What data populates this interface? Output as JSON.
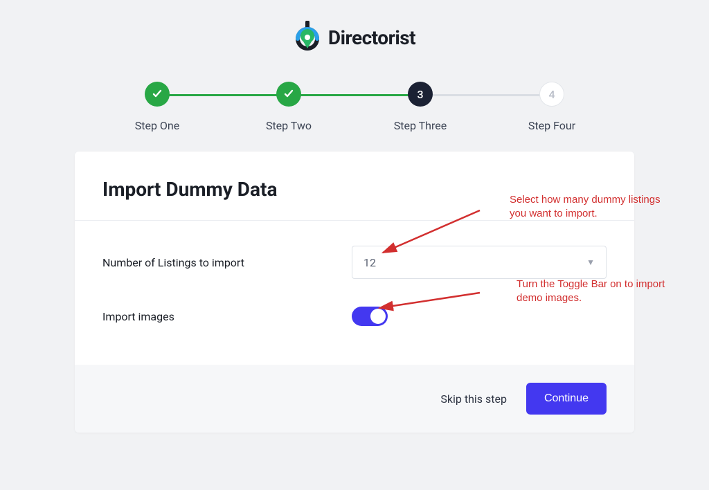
{
  "brand": {
    "name": "Directorist"
  },
  "stepper": {
    "steps": [
      {
        "label": "Step One",
        "state": "done",
        "display": "✓"
      },
      {
        "label": "Step Two",
        "state": "done",
        "display": "✓"
      },
      {
        "label": "Step Three",
        "state": "current",
        "display": "3"
      },
      {
        "label": "Step Four",
        "state": "pending",
        "display": "4"
      }
    ]
  },
  "card": {
    "title": "Import Dummy Data",
    "fields": {
      "listings_label": "Number of Listings to import",
      "listings_value": "12",
      "images_label": "Import images",
      "images_on": true
    }
  },
  "footer": {
    "skip_label": "Skip this step",
    "continue_label": "Continue"
  },
  "annotations": {
    "listings_hint": "Select how many dummy listings you want to import.",
    "images_hint": "Turn the Toggle Bar on to import demo images."
  }
}
